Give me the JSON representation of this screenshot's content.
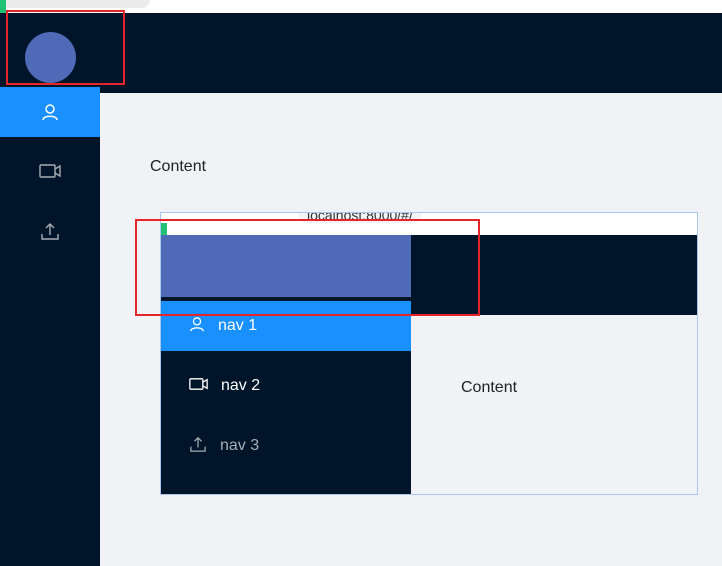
{
  "header": {
    "avatar_icon": "user-avatar",
    "accent_color": "#001529",
    "avatar_color": "#4f6bb7"
  },
  "sidebar": {
    "items": [
      {
        "icon": "user-icon",
        "active": true
      },
      {
        "icon": "video-camera-icon",
        "active": false
      },
      {
        "icon": "upload-icon",
        "active": false
      }
    ],
    "active_color": "#1890ff"
  },
  "main": {
    "content_label": "Content"
  },
  "embedded_screenshot": {
    "url": "localhost:8000/#/",
    "nav_items": [
      {
        "label": "nav 1",
        "icon": "user-icon",
        "active": true
      },
      {
        "label": "nav 2",
        "icon": "video-camera-icon",
        "active": false
      },
      {
        "label": "nav 3",
        "icon": "upload-icon",
        "active": false
      }
    ],
    "content_label": "Content"
  },
  "annotations": {
    "highlight_color": "#e4262b"
  }
}
